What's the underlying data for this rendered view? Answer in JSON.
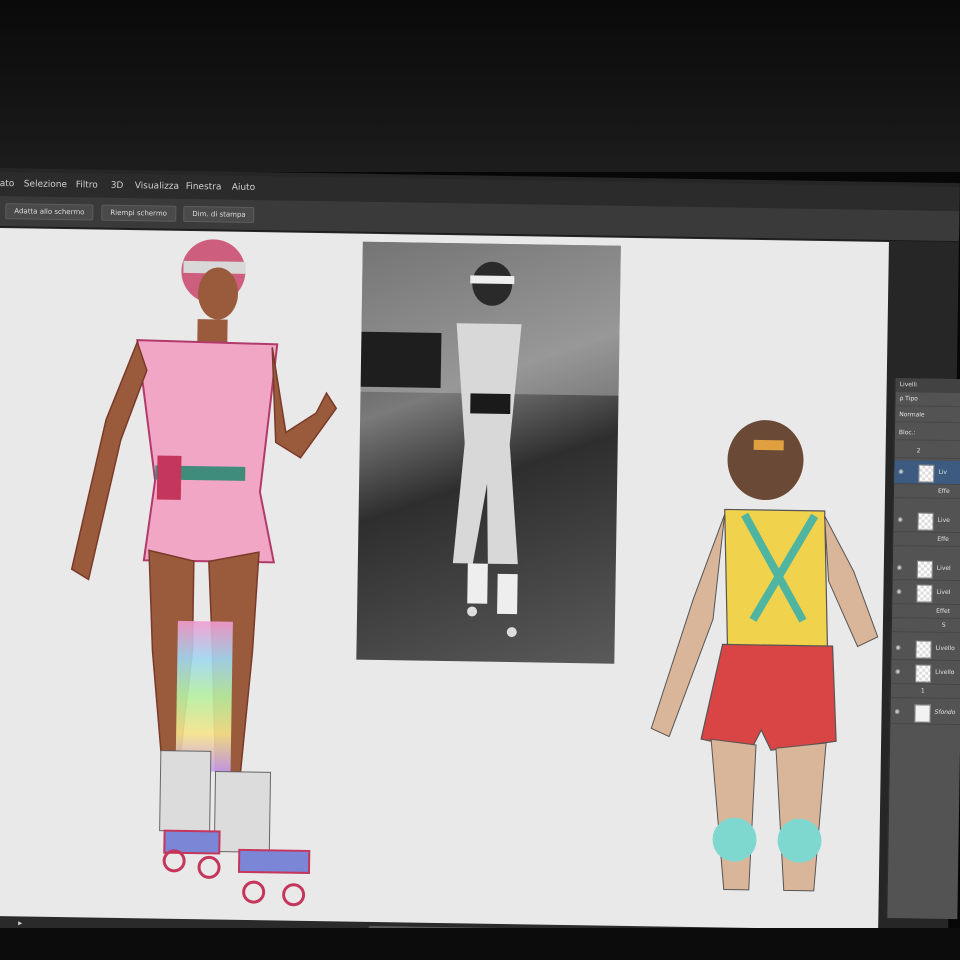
{
  "menu": {
    "items": [
      "ato",
      "Selezione",
      "Filtro",
      "3D",
      "Visualizza",
      "Finestra",
      "Aiuto"
    ]
  },
  "options_bar": {
    "buttons": [
      "Adatta allo schermo",
      "Riempi schermo",
      "Dim. di stampa"
    ]
  },
  "layers_panel": {
    "tab_label": "Livelli",
    "filter_label": "ρ Tipo",
    "blend_mode": "Normale",
    "lock_label": "Bloc.:",
    "group_top_label": "2",
    "layers": [
      {
        "name": "Liv",
        "selected": true
      },
      {
        "name": "Effe",
        "selected": false
      },
      {
        "name": "Live",
        "selected": false
      },
      {
        "name": "Effe",
        "selected": false
      },
      {
        "name": "Livel",
        "selected": false
      },
      {
        "name": "Livel",
        "selected": false
      },
      {
        "name": "Effet",
        "selected": false
      },
      {
        "name": "S",
        "selected": false
      },
      {
        "name": "Livello",
        "selected": false
      },
      {
        "name": "Livello",
        "selected": false
      }
    ],
    "group_bottom_label": "1",
    "background_label": "Sfondo"
  },
  "colors": {
    "canvas": "#e9e9e9",
    "panel": "#535353",
    "menubar": "#2b2b2b",
    "selection": "#3d5a80"
  }
}
